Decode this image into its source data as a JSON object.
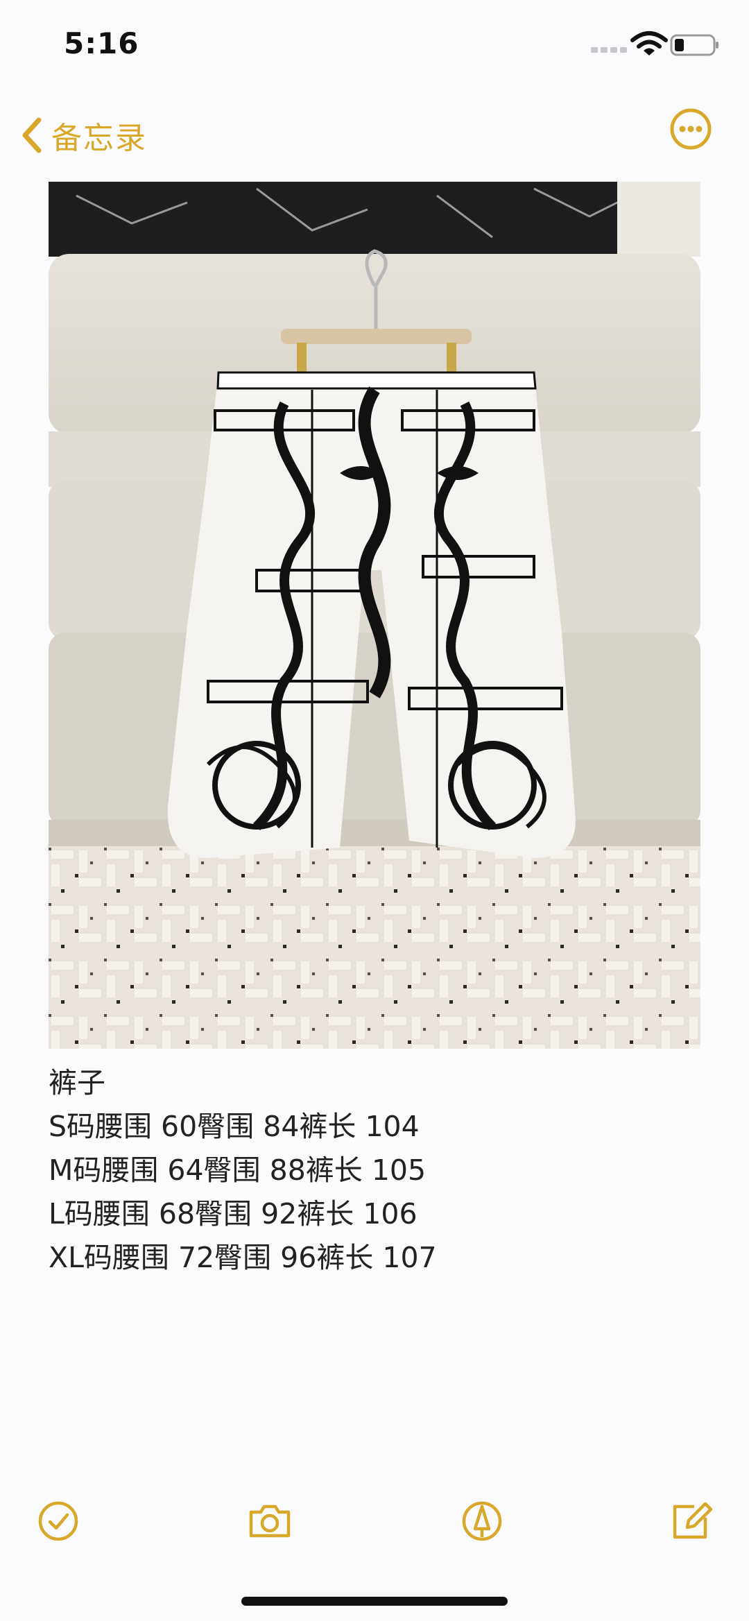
{
  "status_bar": {
    "time": "5:16",
    "icons": [
      "signal-icon",
      "wifi-icon",
      "battery-icon"
    ]
  },
  "nav": {
    "back_label": "备忘录",
    "back_icon": "chevron-left-icon",
    "more_icon": "ellipsis-circle-icon"
  },
  "theme": {
    "accent": "#d8a82a",
    "text": "#222222",
    "background": "#fbfbfd"
  },
  "note": {
    "image": "photo of white wide-leg trousers with black chain and belt print hanging on a hanger in front of a beige sofa",
    "lines": [
      "裤子",
      "S码腰围 60臀围 84裤长 104",
      "M码腰围 64臀围 88裤长 105",
      "L码腰围 68臀围 92裤长 106",
      "XL码腰围 72臀围 96裤长 107"
    ]
  },
  "toolbar": {
    "icons": [
      "checklist-icon",
      "camera-icon",
      "markup-pen-icon",
      "compose-icon"
    ]
  }
}
